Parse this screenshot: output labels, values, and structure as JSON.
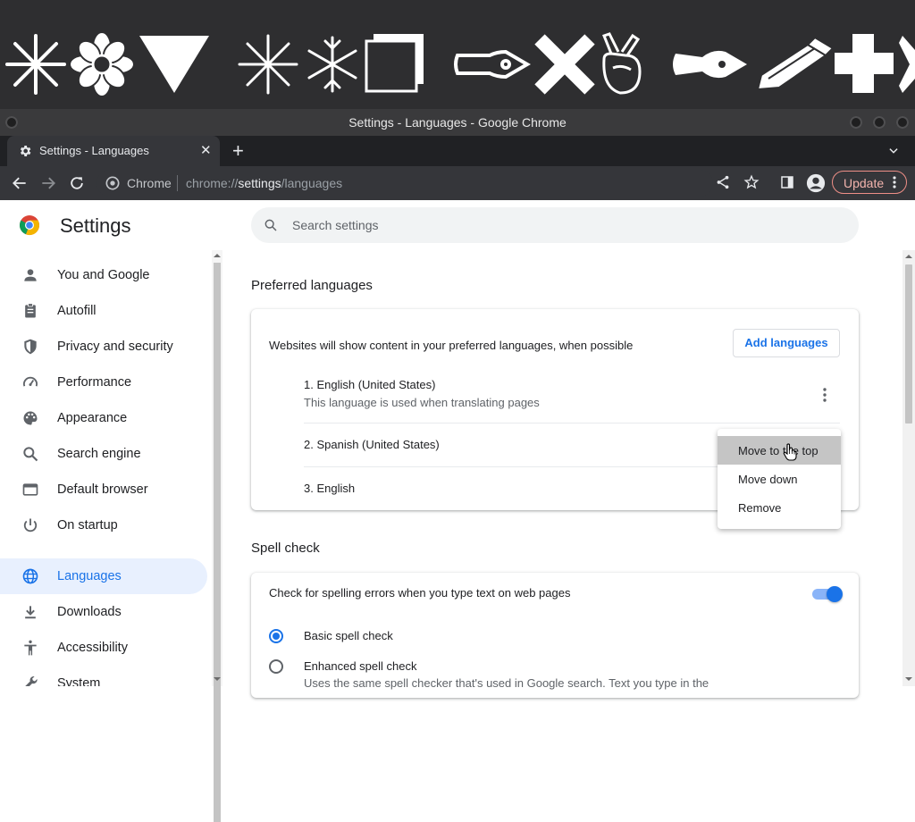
{
  "window": {
    "title": "Settings - Languages - Google Chrome"
  },
  "tab": {
    "label": "Settings - Languages",
    "close_glyph": "✕",
    "new_tab_glyph": "+"
  },
  "toolbar": {
    "site_label": "Chrome",
    "url_prefix": "chrome://",
    "url_host": "settings",
    "url_path": "/languages",
    "update_label": "Update"
  },
  "settings": {
    "title": "Settings",
    "search_placeholder": "Search settings"
  },
  "sidebar": {
    "items": [
      {
        "label": "You and Google",
        "icon": "person-icon"
      },
      {
        "label": "Autofill",
        "icon": "clipboard-icon"
      },
      {
        "label": "Privacy and security",
        "icon": "shield-icon"
      },
      {
        "label": "Performance",
        "icon": "speedometer-icon"
      },
      {
        "label": "Appearance",
        "icon": "palette-icon"
      },
      {
        "label": "Search engine",
        "icon": "search-icon"
      },
      {
        "label": "Default browser",
        "icon": "browser-window-icon"
      },
      {
        "label": "On startup",
        "icon": "power-icon"
      },
      {
        "label": "Languages",
        "icon": "globe-icon",
        "active": true
      },
      {
        "label": "Downloads",
        "icon": "download-icon"
      },
      {
        "label": "Accessibility",
        "icon": "accessibility-icon"
      },
      {
        "label": "System",
        "icon": "wrench-icon"
      }
    ]
  },
  "preferred_languages": {
    "section_title": "Preferred languages",
    "description": "Websites will show content in your preferred languages, when possible",
    "add_button": "Add languages",
    "languages": [
      {
        "label": "1. English (United States)",
        "sublabel": "This language is used when translating pages"
      },
      {
        "label": "2. Spanish (United States)"
      },
      {
        "label": "3. English"
      }
    ]
  },
  "context_menu": {
    "items": [
      "Move to the top",
      "Move down",
      "Remove"
    ],
    "hovered_index": 0
  },
  "spell_check": {
    "section_title": "Spell check",
    "toggle_label": "Check for spelling errors when you type text on web pages",
    "toggle_on": true,
    "options": [
      {
        "label": "Basic spell check",
        "selected": true
      },
      {
        "label": "Enhanced spell check",
        "selected": false,
        "sublabel": "Uses the same spell checker that's used in Google search. Text you type in the"
      }
    ]
  },
  "colors": {
    "accent": "#1a73e8",
    "active_nav_bg": "#e8f0fe",
    "chrome_dark": "#35363a",
    "update_border": "#ee8f87"
  }
}
